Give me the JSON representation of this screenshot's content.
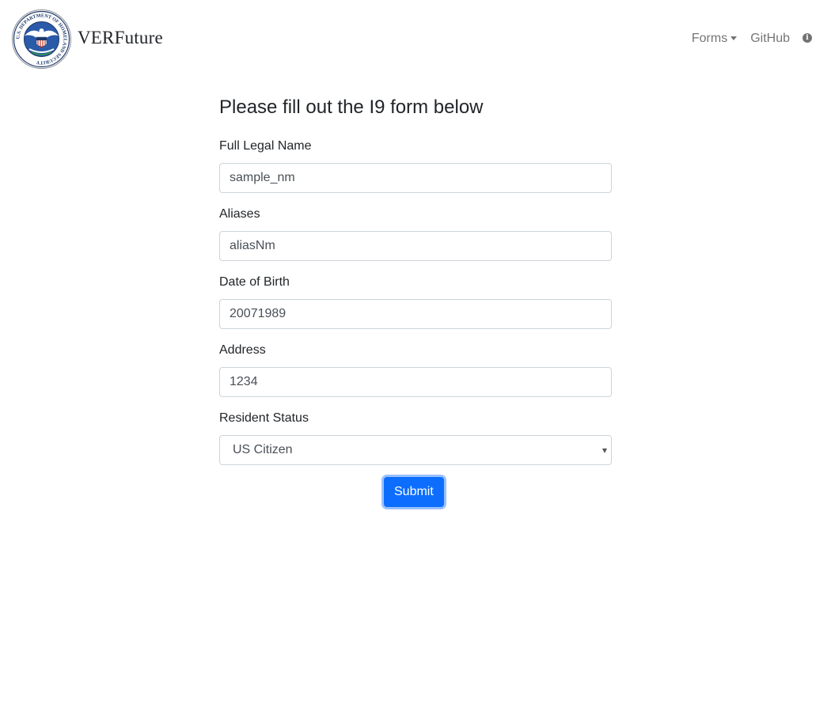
{
  "navbar": {
    "brand_name": "VERFuture",
    "seal_icon": "dhs-seal-icon",
    "forms_label": "Forms",
    "github_label": "GitHub",
    "info_icon": "info-circle-icon",
    "seal_text": "U.S. DEPARTMENT OF HOMELAND SECURITY"
  },
  "form": {
    "title": "Please fill out the I9 form below",
    "fields": {
      "full_name": {
        "label": "Full Legal Name",
        "value": "sample_nm"
      },
      "aliases": {
        "label": "Aliases",
        "value": "aliasNm"
      },
      "dob": {
        "label": "Date of Birth",
        "value": "20071989"
      },
      "address": {
        "label": "Address",
        "value": "1234"
      },
      "resident_status": {
        "label": "Resident Status",
        "value": "US Citizen"
      }
    },
    "submit_label": "Submit"
  },
  "colors": {
    "primary": "#0d6efd",
    "border": "#ced4da",
    "seal_blue": "#1f3a6b"
  }
}
